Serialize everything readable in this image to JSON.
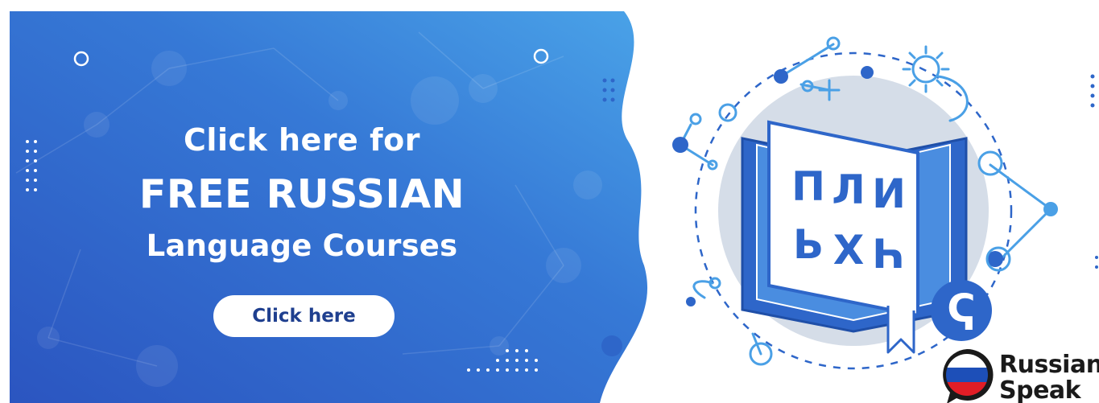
{
  "banner": {
    "headline_line1": "Click here for",
    "headline_line2": "FREE RUSSIAN",
    "headline_line3": "Language Courses",
    "cta_label": "Click here"
  },
  "book": {
    "letters_row1": [
      "П",
      "Л",
      "И"
    ],
    "letters_row2": [
      "Ь",
      "Х",
      "Һ"
    ],
    "badge_glyph": "Ҁ"
  },
  "brand": {
    "name_line1": "Russian",
    "name_line2": "Speak",
    "flag_colors": [
      "#ffffff",
      "#1d4fb8",
      "#e11d26"
    ]
  },
  "colors": {
    "banner_gradient_start": "#2b5ac4",
    "banner_gradient_end": "#4a9be2",
    "accent_blue": "#2e66c9",
    "light_blue": "#4aa0e6",
    "circle_gray": "#d5dde8",
    "button_text": "#1f3f8f"
  }
}
